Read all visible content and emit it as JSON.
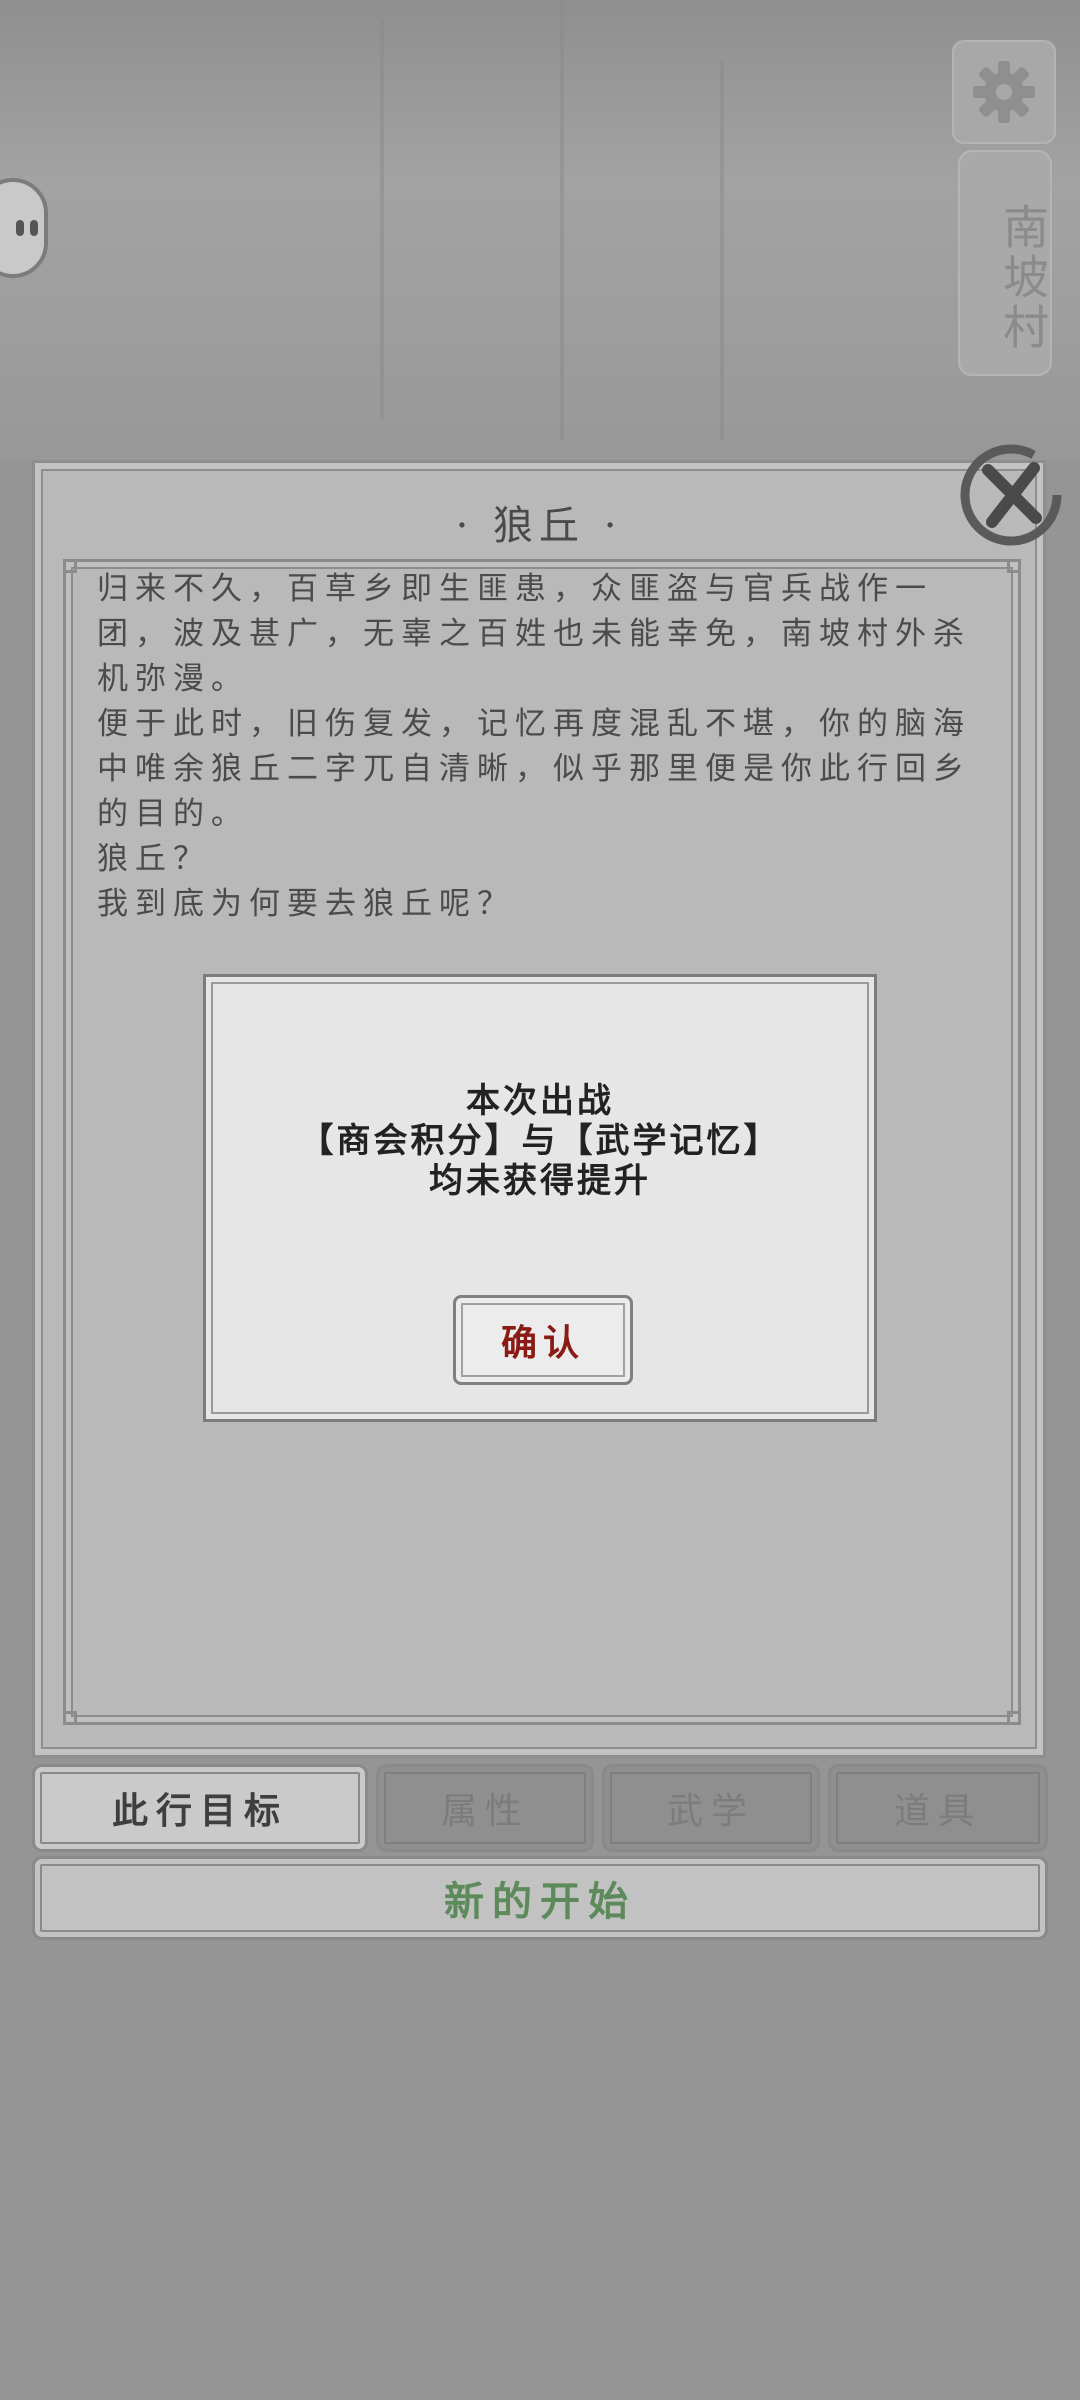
{
  "top_bar": {
    "location_label": "南坡村",
    "settings_icon": "gear-icon",
    "float_icon": "assistant-face-icon"
  },
  "panel": {
    "title": "· 狼丘 ·",
    "close_icon": "close-x-icon",
    "story_paragraphs": [
      "归来不久，百草乡即生匪患，众匪盗与官兵战作一团，波及甚广，无辜之百姓也未能幸免，南坡村外杀机弥漫。",
      "便于此时，旧伤复发，记忆再度混乱不堪，你的脑海中唯余狼丘二字兀自清晰，似乎那里便是你此行回乡的目的。",
      "狼丘？",
      "我到底为何要去狼丘呢？"
    ]
  },
  "dialog": {
    "line1": "本次出战",
    "line2": "【商会积分】与【武学记忆】",
    "line3": "均未获得提升",
    "confirm_label": "确认"
  },
  "tabs": [
    {
      "label": "此行目标",
      "active": true
    },
    {
      "label": "属性",
      "active": false
    },
    {
      "label": "武学",
      "active": false
    },
    {
      "label": "道具",
      "active": false
    }
  ],
  "new_start_label": "新的开始"
}
